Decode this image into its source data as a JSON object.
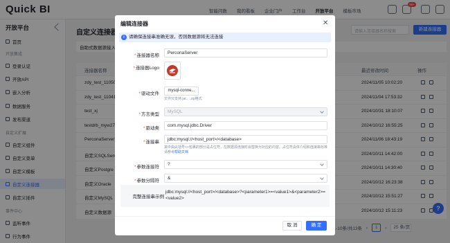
{
  "app": {
    "logo": "Quick BI",
    "nav": [
      "智能问数",
      "我的看板",
      "企业门户",
      "工作台",
      "开放平台",
      "模板市场"
    ],
    "active_nav": "开放平台",
    "notification_count": "99+"
  },
  "sidebar": {
    "title": "开放平台",
    "items": {
      "home": "首页",
      "group_integration": "开放集成",
      "login_auth": "登录认证",
      "open_api": "开放API",
      "embed_analysis": "嵌入分析",
      "data_service": "数据服务",
      "publish_channel": "发布渠道",
      "group_extension": "自定义扩展",
      "custom_component": "自定义组件",
      "custom_menu": "自定义菜单",
      "custom_template": "自定义模板",
      "custom_connector": "自定义连接器",
      "custom_plugin": "自定义插件",
      "group_event": "事件中心",
      "monitor_event": "监听事件",
      "behavior_event": "行为事件"
    }
  },
  "main": {
    "title": "自定义连接器",
    "search_placeholder": "请输入连接器名称搜索",
    "new_button": "新建连接器",
    "tab": "自助式数据源接入,",
    "columns": {
      "name": "连接器名称",
      "time": "最近修改时间",
      "action": "操作"
    },
    "rows": [
      {
        "name": "zdy_test_11050",
        "time": "2024/11/05 10:02:20"
      },
      {
        "name": "zdy_test_11041",
        "time": "2024/11/04 17:53:32"
      },
      {
        "name": "test_xj",
        "time": "2024/10/31 18:10:07"
      },
      {
        "name": "testdrb_myw27",
        "time": "2024/10/12 16:55:25"
      },
      {
        "name": "PerconaServer",
        "time": "2024/11/06 18:43:19"
      },
      {
        "name": "自定义SQLServer",
        "time": "2024/10/11 14:42:00"
      },
      {
        "name": "自定义Postgre",
        "time": "2024/10/11 14:30:40"
      },
      {
        "name": "自定义Oracle",
        "time": "2024/10/12 16:23:38"
      },
      {
        "name": "自定义MySQL",
        "time": "2024/10/12 15:51:27"
      },
      {
        "name": "自定义数据源",
        "time": "2024/10/12 15:11:23"
      }
    ],
    "pager": {
      "range": "第1-10条/共13条",
      "current": "1",
      "page_size": "25 条/页"
    },
    "help_glyph": "?"
  },
  "modal": {
    "title": "编辑连接器",
    "alert": "请确保连接串准确无误，否则数据源将无法连接",
    "fields": {
      "name_label": "连接器名称",
      "name_value": "PerconaServer",
      "logo_label": "连接器Logo",
      "driver_label": "驱动文件",
      "driver_value": "mysql-conne...",
      "driver_hint": "文件只支持.jar、.zip格式",
      "dialect_label": "方言类型",
      "dialect_value": "MySQL",
      "driver_class_label": "驱动类",
      "driver_class_value": "com.mysql.jdbc.Driver",
      "conn_str_label": "连接串",
      "conn_str_value": "jdbc:mysql://<host_port>/<database>",
      "conn_str_hint": "其中由尖括号<>包裹的部分是占位符，在数据源连接时会替换为对应的内容。占位符具体介绍和连接串标准请参考",
      "conn_str_help_link": "帮助文档",
      "param_conn_label": "参数连接符",
      "param_conn_value": "?",
      "param_sep_label": "参数分隔符",
      "param_sep_value": "&",
      "example_label": "完整连接串示例",
      "example_value": "jdbc:mysql://<host_port>/<database>?<parameter1>=<value1>&<parameter2>=<value2>"
    },
    "buttons": {
      "cancel": "取 消",
      "ok": "确 定"
    }
  },
  "colors": {
    "primary": "#3370ff",
    "danger": "#f54a45"
  }
}
